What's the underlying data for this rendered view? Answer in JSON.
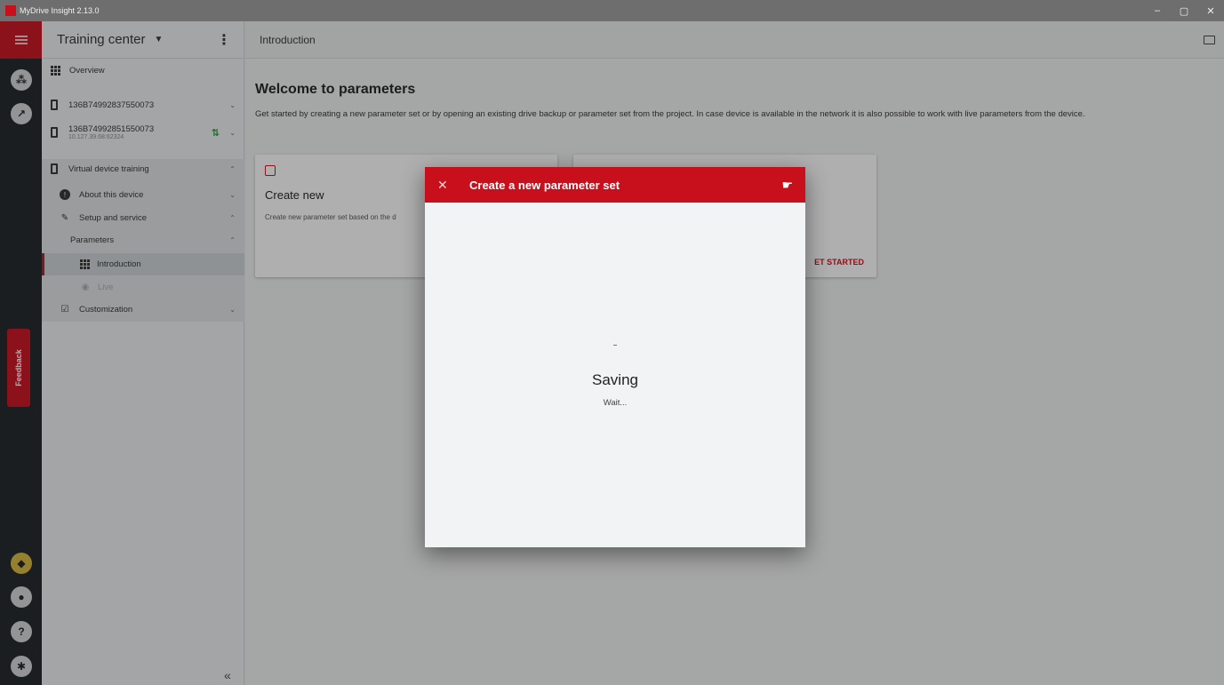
{
  "window": {
    "title": "MyDrive Insight 2.13.0",
    "controls": [
      "–",
      "▢",
      "✕"
    ]
  },
  "rail": {
    "feedback_label": "Feedback",
    "icons": [
      "menu-icon",
      "network-icon",
      "trend-icon",
      "gem-icon",
      "user-icon",
      "help-icon",
      "settings-icon"
    ],
    "help_glyph": "?"
  },
  "sidebar": {
    "title": "Training center",
    "items": [
      {
        "label": "Overview"
      },
      {
        "label": "136B74992837550073"
      },
      {
        "label": "136B74992851550073",
        "sub": "10.127.39.68:62324"
      },
      {
        "label": "Virtual device training"
      },
      {
        "label": "About this device"
      },
      {
        "label": "Setup and service"
      },
      {
        "label": "Parameters"
      },
      {
        "label": "Introduction"
      },
      {
        "label": "Live"
      },
      {
        "label": "Customization"
      }
    ],
    "collapse_glyph": "«"
  },
  "main": {
    "breadcrumb": "Introduction",
    "welcome_title": "Welcome to parameters",
    "welcome_text": "Get started by creating a new parameter set or by opening an existing drive backup or parameter set from the project. In case device is available in the network it is also possible to work with live parameters from the device.",
    "cards": [
      {
        "title": "Create new",
        "description": "Create new parameter set based on the d"
      },
      {
        "action": "ET STARTED"
      }
    ]
  },
  "dialog": {
    "title": "Create a new parameter set",
    "close_glyph": "✕",
    "status_title": "Saving",
    "status_text": "Wait..."
  },
  "colors": {
    "brand_red": "#c8101d",
    "rail_dark": "#1f2326"
  }
}
